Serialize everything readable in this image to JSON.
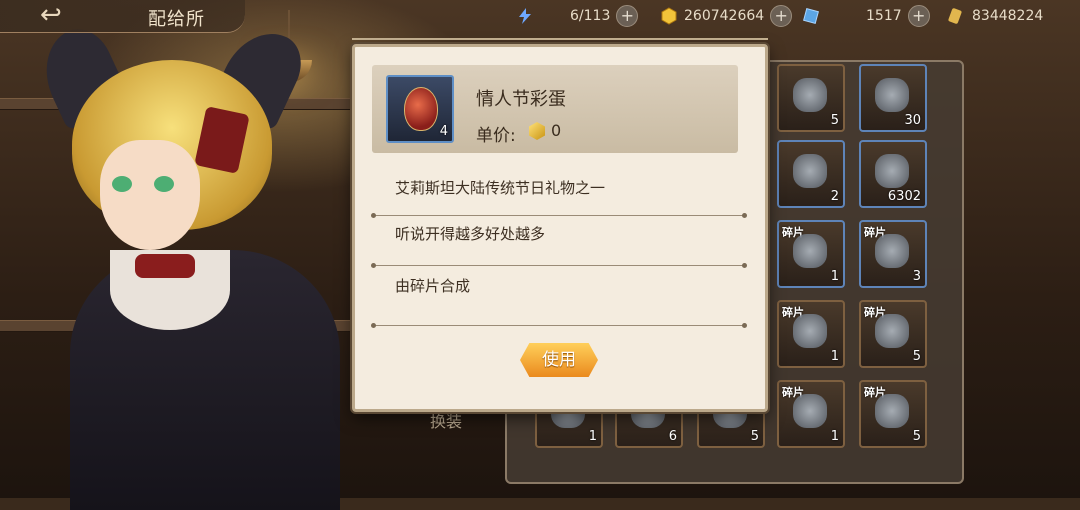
{
  "header": {
    "back_icon": "back-arrow-icon",
    "title": "配给所"
  },
  "resources": [
    {
      "icon": "lightning-icon",
      "value": "6/113",
      "color": "#6ea8ff"
    },
    {
      "icon": "gold-coin-icon",
      "value": "260742664",
      "color": "#f2c43a"
    },
    {
      "icon": "blue-gem-icon",
      "value": "1517",
      "color": "#5ca6e6"
    },
    {
      "icon": "token-icon",
      "value": "83448224",
      "color": "#e2b64e"
    }
  ],
  "inventory": {
    "fragment_label": "碎片",
    "slots": [
      {
        "count": "5"
      },
      {
        "count": "30"
      },
      {
        "count": "2"
      },
      {
        "count": "6302"
      },
      {
        "count": "1",
        "fragment": true
      },
      {
        "count": "3",
        "fragment": true
      },
      {
        "count": "1",
        "fragment": true
      },
      {
        "count": "5",
        "fragment": true
      },
      {
        "count": "1",
        "fragment": true
      },
      {
        "count": "5",
        "fragment": true
      },
      {
        "count": "1"
      },
      {
        "count": "6"
      },
      {
        "count": "5"
      },
      {
        "count": "1"
      },
      {
        "count": "5"
      }
    ]
  },
  "side_label": "换装",
  "dialog": {
    "item_name": "情人节彩蛋",
    "item_count": "4",
    "price_label": "单价:",
    "price_value": "0",
    "descriptions": [
      "艾莉斯坦大陆传统节日礼物之一",
      "听说开得越多好处越多",
      "由碎片合成"
    ],
    "use_button": "使用"
  }
}
